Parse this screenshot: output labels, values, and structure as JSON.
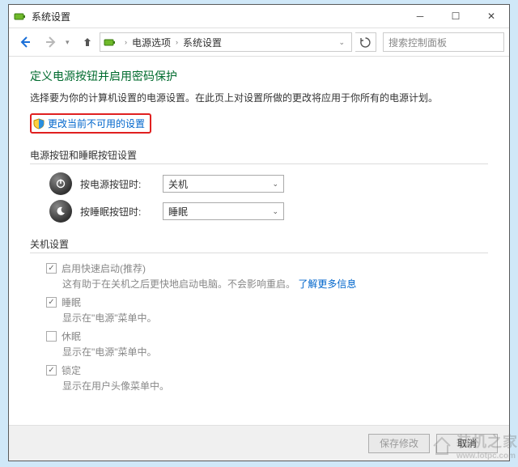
{
  "window": {
    "title": "系统设置"
  },
  "breadcrumb": {
    "item1": "电源选项",
    "item2": "系统设置"
  },
  "search": {
    "placeholder": "搜索控制面板"
  },
  "page": {
    "heading": "定义电源按钮并启用密码保护",
    "desc": "选择要为你的计算机设置的电源设置。在此页上对设置所做的更改将应用于你所有的电源计划。",
    "change_link": "更改当前不可用的设置"
  },
  "section_buttons": {
    "title": "电源按钮和睡眠按钮设置",
    "power_label": "按电源按钮时:",
    "power_value": "关机",
    "sleep_label": "按睡眠按钮时:",
    "sleep_value": "睡眠"
  },
  "section_shutdown": {
    "title": "关机设置",
    "fast": {
      "label": "启用快速启动(推荐)",
      "sub_a": "这有助于在关机之后更快地启动电脑。不会影响重启。",
      "link": "了解更多信息"
    },
    "sleep": {
      "label": "睡眠",
      "sub": "显示在\"电源\"菜单中。"
    },
    "hibernate": {
      "label": "休眠",
      "sub": "显示在\"电源\"菜单中。"
    },
    "lock": {
      "label": "锁定",
      "sub": "显示在用户头像菜单中。"
    }
  },
  "footer": {
    "save": "保存修改",
    "cancel": "取消"
  },
  "watermark": {
    "brand": "装机之家",
    "url": "www.lotpc.com"
  }
}
